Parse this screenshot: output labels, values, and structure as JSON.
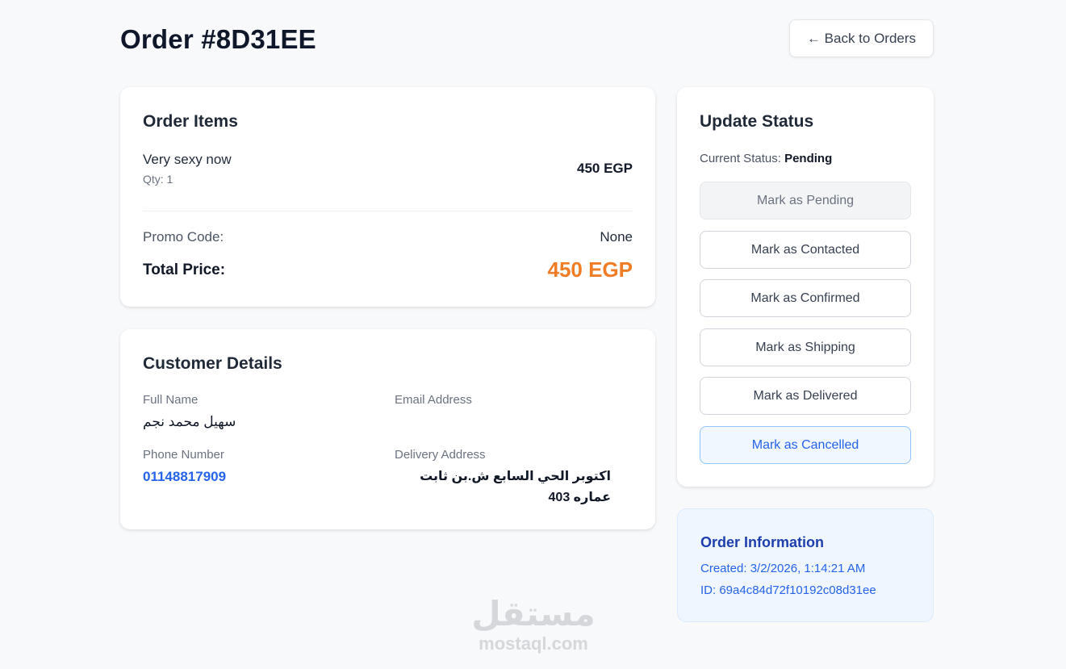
{
  "header": {
    "title": "Order #8D31EE",
    "back_label": "← Back to Orders"
  },
  "order_items": {
    "title": "Order Items",
    "items": [
      {
        "name": "Very sexy now",
        "qty": "Qty: 1",
        "price": "450 EGP"
      }
    ],
    "promo_label": "Promo Code:",
    "promo_value": "None",
    "total_label": "Total Price:",
    "total_value": "450 EGP",
    "total_color": "#f07c25"
  },
  "customer": {
    "title": "Customer Details",
    "full_name_label": "Full Name",
    "full_name": "سهيل محمد نجم",
    "email_label": "Email Address",
    "email": "",
    "phone_label": "Phone Number",
    "phone": "01148817909",
    "address_label": "Delivery Address",
    "address": "اكتوبر الحي السابع ش.بن ثابت عماره 403"
  },
  "status": {
    "title": "Update Status",
    "current_label": "Current Status:",
    "current_value": "Pending",
    "buttons": [
      {
        "label": "Mark as Pending",
        "state": "disabled"
      },
      {
        "label": "Mark as Contacted",
        "state": "normal"
      },
      {
        "label": "Mark as Confirmed",
        "state": "normal"
      },
      {
        "label": "Mark as Shipping",
        "state": "normal"
      },
      {
        "label": "Mark as Delivered",
        "state": "normal"
      },
      {
        "label": "Mark as Cancelled",
        "state": "danger"
      }
    ]
  },
  "info": {
    "title": "Order Information",
    "created": "Created: 3/2/2026, 1:14:21 AM",
    "id": "ID: 69a4c84d72f10192c08d31ee"
  },
  "watermark": {
    "arabic": "مستقل",
    "latin": "mostaql.com"
  },
  "colors": {
    "accent_blue": "#2563eb",
    "total_orange": "#f07c25",
    "info_bg": "#eff6ff"
  }
}
